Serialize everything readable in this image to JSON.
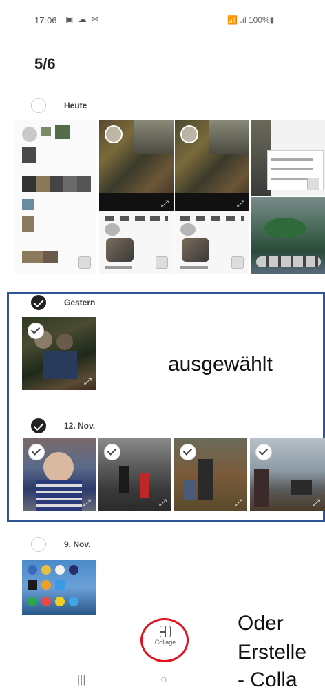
{
  "status": {
    "time": "17:06",
    "icons": "▣ ☁ ✉",
    "right": "📶 .ıl 100%▮"
  },
  "counter": "5/6",
  "sections": [
    {
      "label": "Heute",
      "checked": false
    },
    {
      "label": "Gestern",
      "checked": true
    },
    {
      "label": "12. Nov.",
      "checked": true
    },
    {
      "label": "9. Nov.",
      "checked": false
    }
  ],
  "annotations": {
    "selected": "ausgewählt",
    "or_line1": "Oder",
    "or_line2": "Erstelle",
    "or_line3": " - Colla"
  },
  "bottom_action": {
    "label": "Collage",
    "icon": "collage-icon"
  },
  "nav": {
    "recents": "|||",
    "home": "○",
    "back": "<"
  },
  "colors": {
    "selection_border": "#2f5597",
    "highlight_ring": "#e0141e"
  }
}
